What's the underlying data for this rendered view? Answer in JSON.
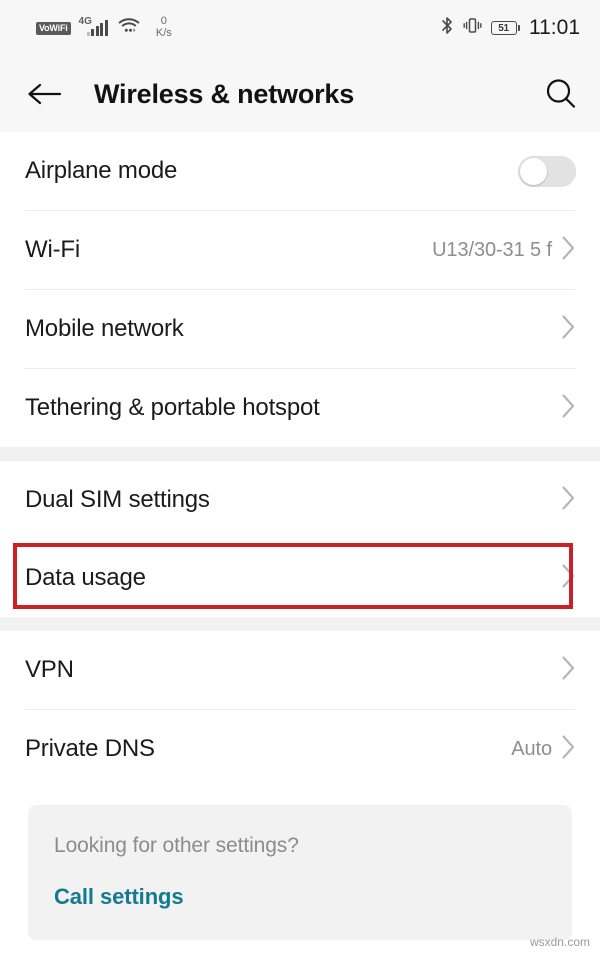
{
  "status_bar": {
    "vowifi_label": "VoWiFi",
    "network_generation": "4G",
    "signal_icon": "signal-bars-icon",
    "wifi_icon": "wifi-icon",
    "data_rate_value": "0",
    "data_rate_unit": "K/s",
    "bluetooth_icon": "bluetooth-icon",
    "vibrate_icon": "vibrate-icon",
    "battery_level": "51",
    "time": "11:01"
  },
  "header": {
    "back_icon": "back-arrow-icon",
    "title": "Wireless & networks",
    "search_icon": "search-icon"
  },
  "sections": [
    {
      "rows": [
        {
          "label": "Airplane mode",
          "control": "toggle",
          "toggle_on": false
        },
        {
          "label": "Wi-Fi",
          "value": "U13/30-31 5 f",
          "control": "chevron"
        },
        {
          "label": "Mobile network",
          "value": "",
          "control": "chevron"
        },
        {
          "label": "Tethering & portable hotspot",
          "value": "",
          "control": "chevron"
        }
      ]
    },
    {
      "rows": [
        {
          "label": "Dual SIM settings",
          "value": "",
          "control": "chevron"
        },
        {
          "label": "Data usage",
          "value": "",
          "control": "chevron",
          "highlighted": true
        }
      ]
    },
    {
      "rows": [
        {
          "label": "VPN",
          "value": "",
          "control": "chevron"
        },
        {
          "label": "Private DNS",
          "value": "Auto",
          "control": "chevron"
        }
      ]
    }
  ],
  "footer": {
    "question": "Looking for other settings?",
    "link_label": "Call settings",
    "link_color": "#127a91"
  },
  "highlight": {
    "target": "Data usage",
    "color": "#cc2028"
  },
  "watermark": "wsxdn.com"
}
